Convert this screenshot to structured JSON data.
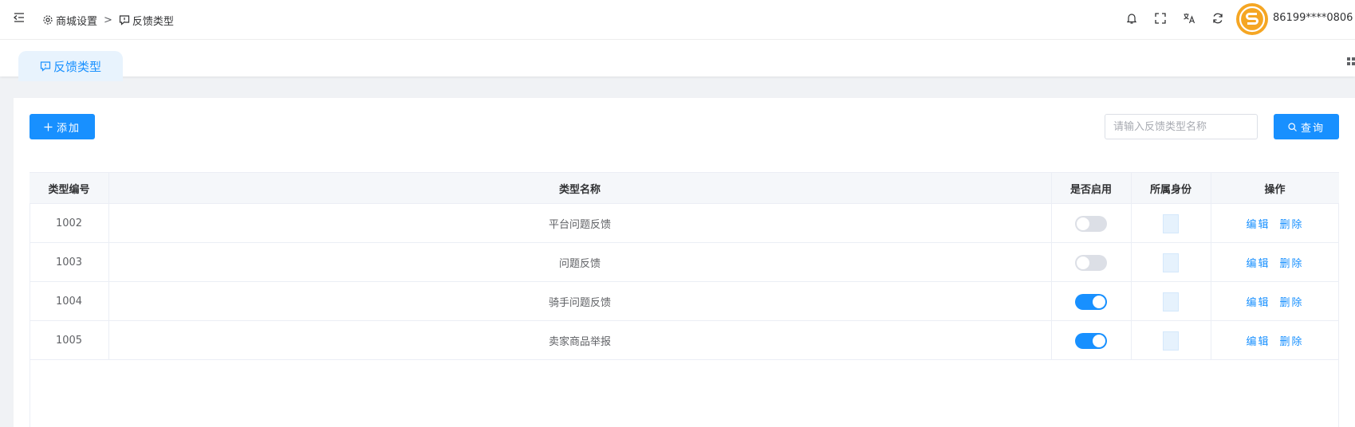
{
  "header": {
    "breadcrumb": [
      "商城设置",
      "反馈类型"
    ],
    "breadcrumb_sep": ">",
    "username": "86199****0806",
    "icons": [
      "menu-fold-icon",
      "gear-icon",
      "message-icon",
      "bell-icon",
      "fullscreen-icon",
      "translate-icon",
      "refresh-icon",
      "avatar",
      "chevron-down-icon"
    ]
  },
  "tags": {
    "active_label": "反馈类型"
  },
  "toolbar": {
    "add_label": "添加",
    "search_placeholder": "请输入反馈类型名称",
    "search_value": "",
    "query_label": "查询"
  },
  "table": {
    "columns": [
      "类型编号",
      "类型名称",
      "是否启用",
      "所属身份",
      "操作"
    ],
    "rows": [
      {
        "id": "1002",
        "name": "平台问题反馈",
        "enabled": false,
        "edit": "编辑",
        "delete": "删除"
      },
      {
        "id": "1003",
        "name": "问题反馈",
        "enabled": false,
        "edit": "编辑",
        "delete": "删除"
      },
      {
        "id": "1004",
        "name": "骑手问题反馈",
        "enabled": true,
        "edit": "编辑",
        "delete": "删除"
      },
      {
        "id": "1005",
        "name": "卖家商品举报",
        "enabled": true,
        "edit": "编辑",
        "delete": "删除"
      }
    ]
  },
  "colors": {
    "primary": "#1890ff",
    "avatar": "#f5a623",
    "switch_off": "#dcdfe6"
  }
}
